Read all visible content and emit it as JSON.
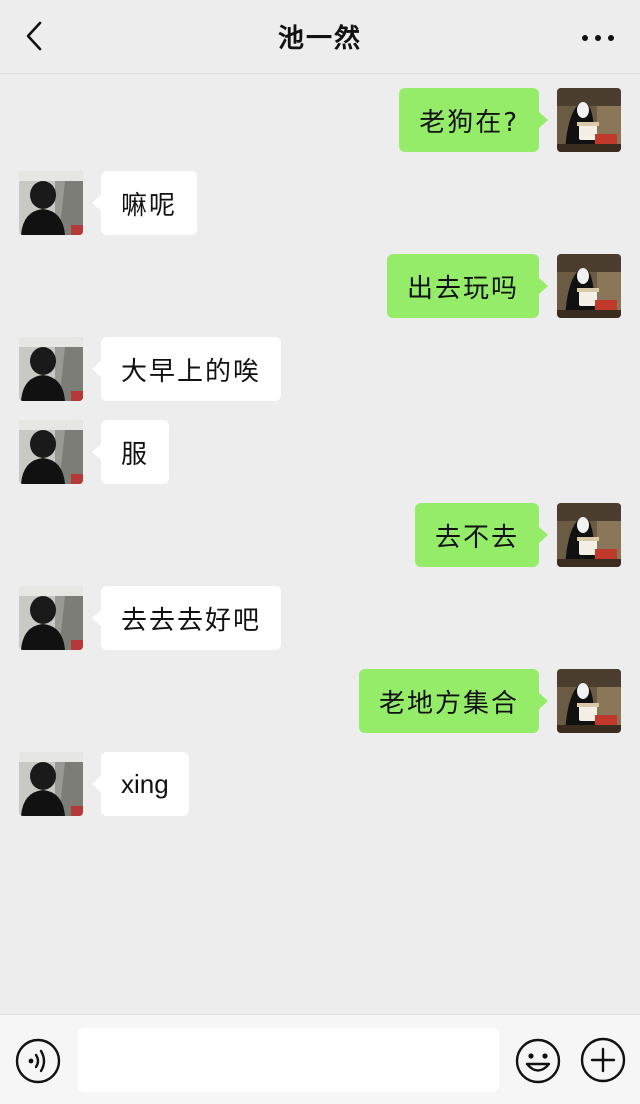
{
  "header": {
    "title": "池一然",
    "back_icon": "chevron-left-icon",
    "more_icon": "more-dots-icon"
  },
  "colors": {
    "background": "#ededed",
    "outgoing_bubble": "#95ec69",
    "incoming_bubble": "#ffffff"
  },
  "messages": [
    {
      "side": "right",
      "text": "老狗在?"
    },
    {
      "side": "left",
      "text": "嘛呢"
    },
    {
      "side": "right",
      "text": "出去玩吗"
    },
    {
      "side": "left",
      "text": "大早上的唉"
    },
    {
      "side": "left",
      "text": "服"
    },
    {
      "side": "right",
      "text": "去不去"
    },
    {
      "side": "left",
      "text": "去去去好吧"
    },
    {
      "side": "right",
      "text": "老地方集合"
    },
    {
      "side": "left",
      "text": "xing"
    }
  ],
  "input_bar": {
    "input_value": "",
    "voice_icon": "voice-icon",
    "emoji_icon": "emoji-icon",
    "plus_icon": "plus-icon"
  }
}
